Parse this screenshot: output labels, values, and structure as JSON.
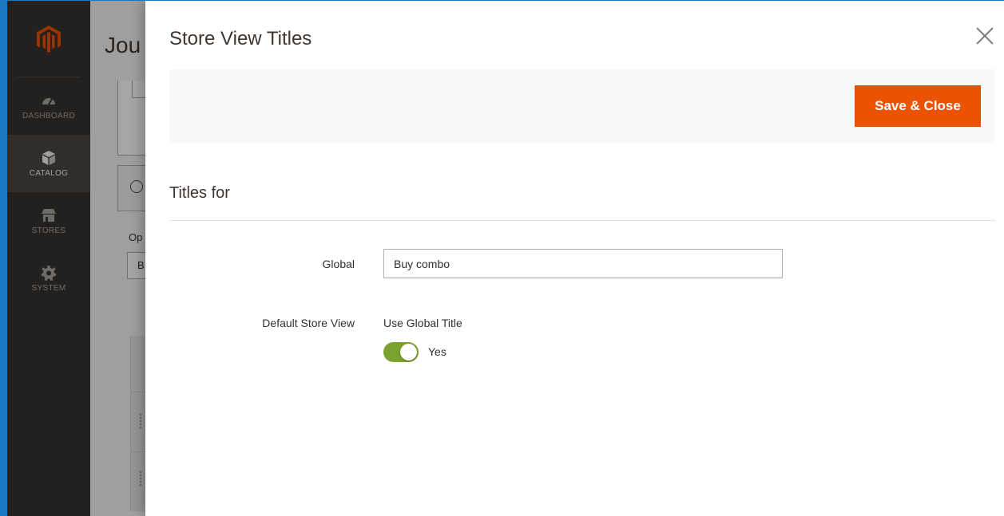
{
  "admin_menu": {
    "logo_icon": "magento-logo-icon",
    "brand_color": "#eb5202",
    "items": [
      {
        "label": "DASHBOARD",
        "icon": "dashboard-icon",
        "active": false
      },
      {
        "label": "CATALOG",
        "icon": "cube-icon",
        "active": true
      },
      {
        "label": "STORES",
        "icon": "store-icon",
        "active": false
      },
      {
        "label": "SYSTEM",
        "icon": "gear-icon",
        "active": false
      }
    ]
  },
  "background_page": {
    "title_fragment": "Jou",
    "label_fragment": "Op",
    "input_fragment": "B"
  },
  "modal": {
    "title": "Store View Titles",
    "close_icon": "close-icon",
    "save_button": "Save & Close",
    "section_title": "Titles for",
    "global_label": "Global",
    "global_value": "Buy combo",
    "default_store_view_label": "Default Store View",
    "use_global_title_label": "Use Global Title",
    "toggle_value": "Yes",
    "toggle_on": true,
    "toggle_color": "#79a22e"
  }
}
